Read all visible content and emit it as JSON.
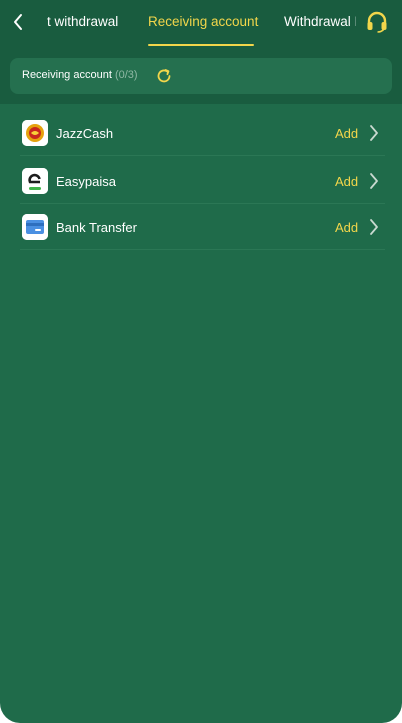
{
  "tabs": [
    {
      "label": "t withdrawal",
      "active": false
    },
    {
      "label": "Receiving account",
      "active": true
    },
    {
      "label": "Withdrawal I",
      "active": false
    }
  ],
  "header": {
    "account_label": "Receiving account",
    "account_count": "(0/3)"
  },
  "accounts": [
    {
      "name": "JazzCash",
      "action": "Add",
      "icon": "jazzcash-logo"
    },
    {
      "name": "Easypaisa",
      "action": "Add",
      "icon": "easypaisa-logo"
    },
    {
      "name": "Bank Transfer",
      "action": "Add",
      "icon": "bank-card-icon"
    }
  ],
  "colors": {
    "background": "#1f6b4a",
    "header": "#195c3f",
    "accent": "#f2d64b"
  }
}
